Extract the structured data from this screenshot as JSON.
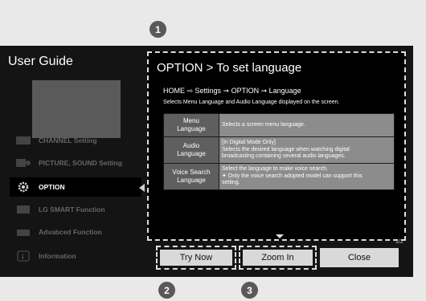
{
  "guide": {
    "title": "User Guide"
  },
  "sidebar": {
    "items": [
      {
        "label": "CHANNEL Setting",
        "icon": "tv-icon",
        "active": false
      },
      {
        "label": "PICTURE, SOUND Setting",
        "icon": "picture-sound-icon",
        "active": false
      },
      {
        "label": "OPTION",
        "icon": "gear-icon",
        "active": true
      },
      {
        "label": "LG SMART Function",
        "icon": "smart-icon",
        "active": false
      },
      {
        "label": "Advabced Function",
        "icon": "advanced-icon",
        "active": false
      },
      {
        "label": "Information",
        "icon": "info-icon",
        "active": false
      }
    ]
  },
  "panel": {
    "title": "OPTION > To set language",
    "path": "HOME ⇨ Settings ➞ OPTION ➞ Language",
    "description": "Selects Menu Language and Audio Language displayed on the screen.",
    "rows": [
      {
        "key": "Menu\nLanguage",
        "value": "Selects a screen menu language."
      },
      {
        "key": "Audio\nLanguage",
        "value": "[In Digital Mode Only]\nSelects the desired language when watching digital\nbroadcasting containing several audio languages."
      },
      {
        "key": "Voice Search\nLanguage",
        "value": "Select the language to make voice search.\n✦ Only the voice search adopted model can support this\n    setting."
      }
    ],
    "page_indicator": "1/2"
  },
  "buttons": {
    "try_now": "Try Now",
    "zoom_in": "Zoom In",
    "close": "Close"
  },
  "callouts": {
    "one": "1",
    "two": "2",
    "three": "3"
  }
}
